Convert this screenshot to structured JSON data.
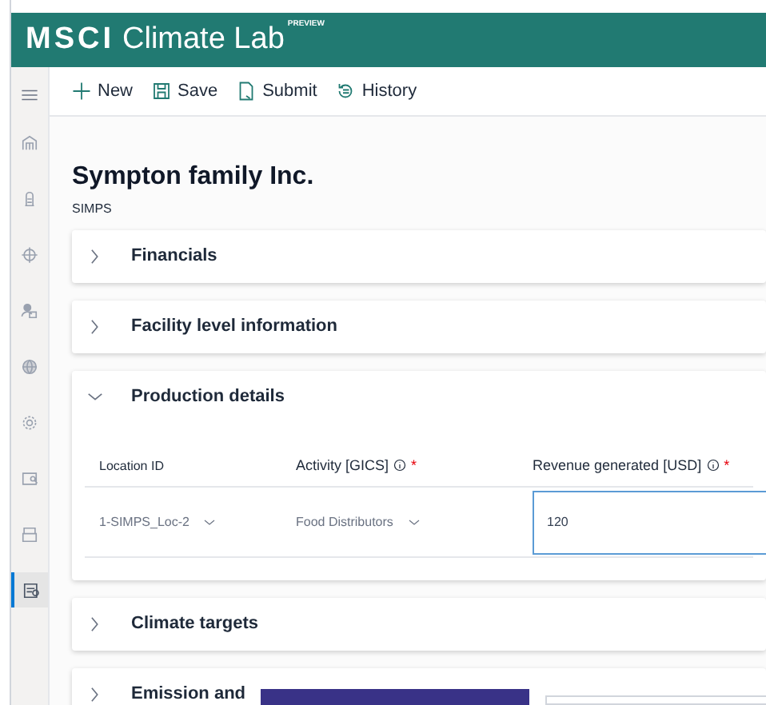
{
  "header": {
    "brand": "MSCI",
    "product": "Climate Lab",
    "badge": "PREVIEW"
  },
  "sidebar": {
    "items": [
      {
        "kind": "home",
        "selected": false
      },
      {
        "kind": "building",
        "selected": false
      },
      {
        "kind": "target",
        "selected": false
      },
      {
        "kind": "people",
        "selected": false
      },
      {
        "kind": "globe",
        "selected": false
      },
      {
        "kind": "gear",
        "selected": false
      },
      {
        "kind": "report",
        "selected": false
      },
      {
        "kind": "folder",
        "selected": false
      },
      {
        "kind": "form",
        "selected": true
      }
    ]
  },
  "toolbar": [
    {
      "kind": "plus",
      "label": "New"
    },
    {
      "kind": "save",
      "label": "Save"
    },
    {
      "kind": "submit",
      "label": "Submit"
    },
    {
      "kind": "history",
      "label": "History"
    }
  ],
  "company": {
    "name": "Sympton family Inc.",
    "code": "SIMPS"
  },
  "sections": [
    {
      "title": "Financials",
      "expanded": false
    },
    {
      "title": "Facility level information",
      "expanded": false
    },
    {
      "title": "Production details",
      "expanded": true,
      "table": {
        "columns": [
          {
            "label": "Location ID",
            "info": false
          },
          {
            "label": "Activity [GICS]",
            "info": true,
            "marker": "*"
          },
          {
            "label": "Revenue generated [USD]",
            "info": true,
            "marker": "*"
          }
        ],
        "rows": [
          {
            "location": "1-SIMPS_Loc-2",
            "activity": "Food Distributors",
            "revenue": "120"
          }
        ]
      }
    },
    {
      "title": "Climate targets",
      "expanded": false
    },
    {
      "title": "Emission and",
      "expanded": false
    }
  ]
}
